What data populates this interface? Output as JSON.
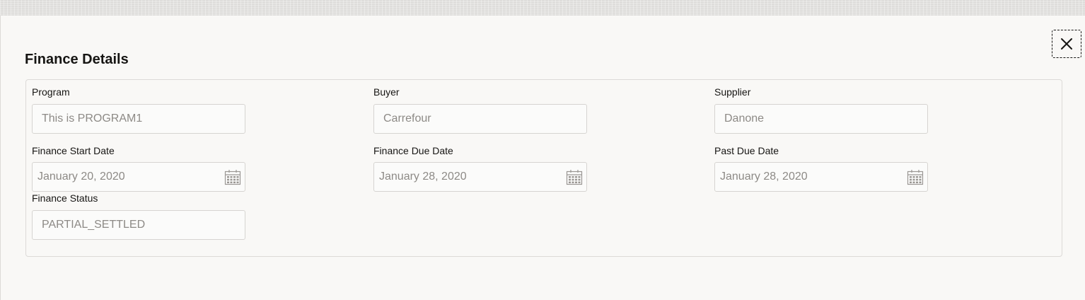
{
  "dialog": {
    "title": "Finance Details",
    "close_glyph": "×"
  },
  "fields": {
    "program": {
      "label": "Program",
      "value": "This is PROGRAM1"
    },
    "buyer": {
      "label": "Buyer",
      "value": "Carrefour"
    },
    "supplier": {
      "label": "Supplier",
      "value": "Danone"
    },
    "finance_start_date": {
      "label": "Finance Start Date",
      "value": "January 20, 2020"
    },
    "finance_due_date": {
      "label": "Finance Due Date",
      "value": "January 28, 2020"
    },
    "past_due_date": {
      "label": "Past Due Date",
      "value": "January 28, 2020"
    },
    "finance_status": {
      "label": "Finance Status",
      "value": "PARTIAL_SETTLED"
    }
  },
  "icons": {
    "close": "close-icon",
    "calendar": "calendar-icon"
  },
  "colors": {
    "background": "#f9f8f6",
    "text": "#161513",
    "placeholder_text": "#8d8a86",
    "border": "#d6d4d1"
  }
}
